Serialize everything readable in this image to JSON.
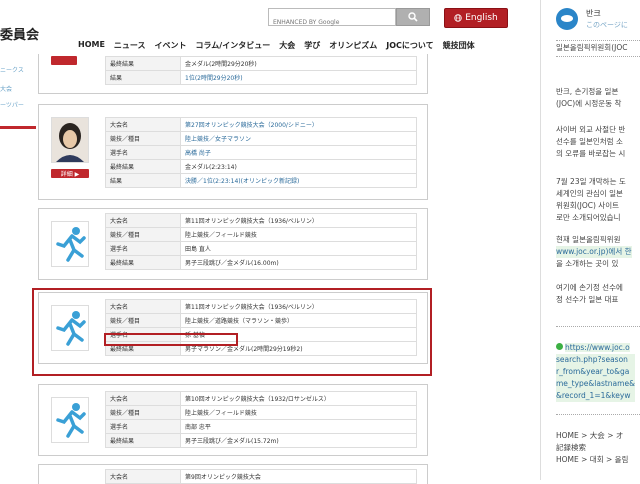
{
  "header": {
    "site_title": "委員会",
    "search_placeholder": "ENHANCED BY Google",
    "lang_button": "English",
    "nav": [
      "HOME",
      "ニュース",
      "イベント",
      "コラム/インタビュー",
      "大会",
      "学び",
      "オリンピズム",
      "JOCについて",
      "競技団体"
    ]
  },
  "left_fragment": {
    "links": [
      "ニークス",
      "大会",
      "ーツパー"
    ]
  },
  "colors": {
    "brand_red": "#b21f24",
    "highlight_red": "#b21f24"
  },
  "cards": [
    {
      "rows": [
        [
          "最終結果",
          "金メダル(2時間29分20秒)"
        ],
        [
          "結果",
          "1位(2時間29分20秒)"
        ]
      ],
      "icon": "athlete-photo-none"
    },
    {
      "rows": [
        [
          "大会名",
          "第27回オリンピック競技大会（2000/シドニー）"
        ],
        [
          "競技／種目",
          "陸上競技／女子マラソン"
        ],
        [
          "選手名",
          "高橋 尚子"
        ],
        [
          "最終結果",
          "金メダル(2:23:14)"
        ],
        [
          "結果",
          "決勝／1位(2:23:14)(オリンピック新記録)"
        ]
      ],
      "detail": "詳細 ▶"
    },
    {
      "rows": [
        [
          "大会名",
          "第11回オリンピック競技大会（1936/ベルリン）"
        ],
        [
          "競技／種目",
          "陸上競技／フィールド競技"
        ],
        [
          "選手名",
          "田島 直人"
        ],
        [
          "最終結果",
          "男子三段跳び／金メダル(16.00m)"
        ]
      ]
    },
    {
      "rows": [
        [
          "大会名",
          "第11回オリンピック競技大会（1936/ベルリン）"
        ],
        [
          "競技／種目",
          "陸上競技／道路競技（マラソン・競歩）"
        ],
        [
          "選手名",
          "孫 基禎"
        ],
        [
          "最終結果",
          "男子マラソン／金メダル(2時間29分19秒2)"
        ]
      ]
    },
    {
      "rows": [
        [
          "大会名",
          "第10回オリンピック競技大会（1932/ロサンゼルス）"
        ],
        [
          "競技／種目",
          "陸上競技／フィールド競技"
        ],
        [
          "選手名",
          "南部 忠平"
        ],
        [
          "最終結果",
          "男子三段跳び／金メダル(15.72m)"
        ]
      ]
    },
    {
      "rows": [
        [
          "大会名",
          "第9回オリンピック競技大会"
        ]
      ]
    }
  ],
  "right_panel": {
    "name": "반크",
    "sub": "このページに",
    "paragraphs": [
      [
        "일본올림픽위원회(JOC"
      ],
      [
        "반크, 손기정을 일본",
        "(JOC)에 시정운동 착"
      ],
      [
        "사이버 외교 사절단 반",
        "선수를 일본인처럼 소",
        "의 오류를 바로잡는 시"
      ],
      [
        "7월 23일 개막하는 도",
        "세계인의 관심이 일본",
        "위원회(JOC) 사이트",
        "로만 소개되어있습니"
      ],
      [
        "현재 일본올림픽위원",
        "www.joc.or.jp)에서 한",
        "을 소개하는 곳이 있"
      ],
      [
        "여기에 손기정 선수에",
        "정 선수가 일본 대표"
      ]
    ],
    "link_lines": [
      "https://www.joc.o",
      "search.php?season",
      "r_from&year_to&ga",
      "me_type&lastname&",
      "&record_1=1&keyw"
    ],
    "bottom_lines": [
      "HOME > 大会 > オ",
      "記録検索",
      "HOME > 대회 > 올림"
    ]
  }
}
